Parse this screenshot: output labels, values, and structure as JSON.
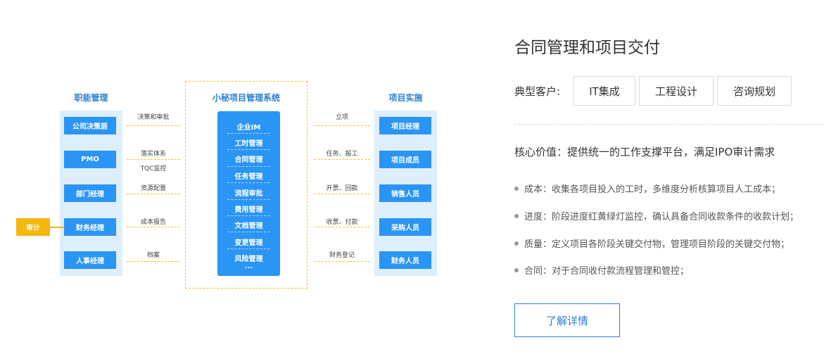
{
  "diagram": {
    "left_title": "职能管理",
    "center_title": "小秘项目管理系统",
    "right_title": "项目实施",
    "left_items": [
      "公司决策层",
      "PMO",
      "部门经理",
      "财务经理",
      "人事经理"
    ],
    "audit": "审计",
    "center_items": [
      "企业IM",
      "工时管理",
      "合同管理",
      "任务管理",
      "流程审批",
      "费用管理",
      "文档管理",
      "变更管理",
      "风险管理"
    ],
    "center_more": "...",
    "right_items": [
      "项目经理",
      "项目成员",
      "销售人员",
      "采购人员",
      "财务人员"
    ],
    "left_labels": [
      "决策和审批",
      "落实体系",
      "TQC监控",
      "资源配置",
      "成本报告",
      "档案"
    ],
    "right_labels": [
      "立项",
      "任务、报工",
      "开票、回款",
      "收票、付款",
      "财务登记"
    ]
  },
  "content": {
    "title": "合同管理和项目交付",
    "customer_label": "典型客户:",
    "customers": [
      "IT集成",
      "工程设计",
      "咨询规划"
    ],
    "core_value": "核心价值：提供统一的工作支撑平台，满足IPO审计需求",
    "bullets": [
      "成本：收集各项目投入的工时，多维度分析核算项目人工成本；",
      "进度：阶段进度红黄绿灯监控，确认具备合同收款条件的收款计划；",
      "质量：定义项目各阶段关键交付物，管理项目阶段的关键交付物；",
      "合同：对于合同收付款流程管理和管控；"
    ],
    "more_button": "了解详情"
  },
  "colors": {
    "primary_blue": "#2b95f5",
    "title_blue": "#2b7fd1",
    "panel_bg": "#deeefb",
    "accent_yellow": "#f6b60a"
  }
}
